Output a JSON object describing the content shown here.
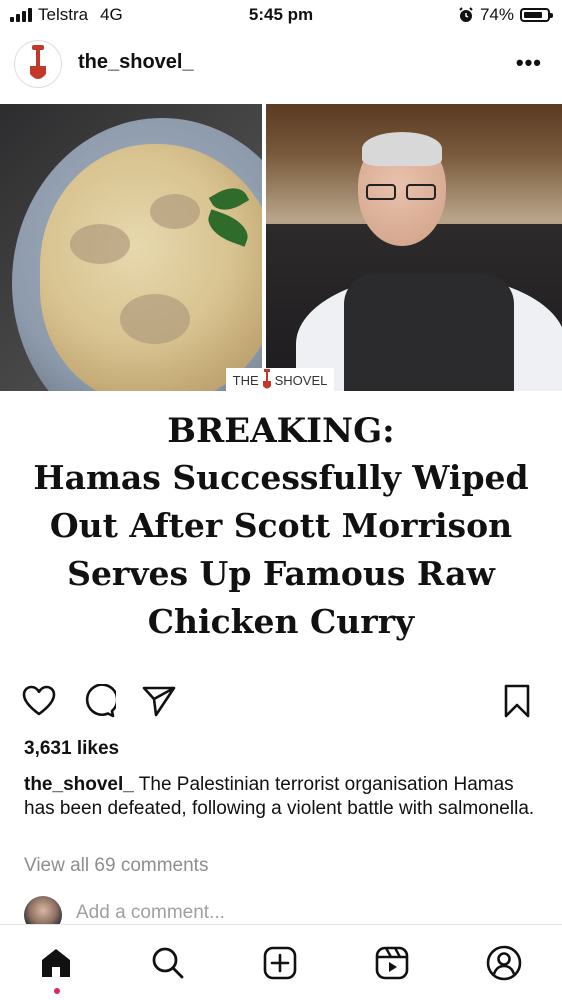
{
  "status_bar": {
    "carrier": "Telstra",
    "network": "4G",
    "time": "5:45 pm",
    "battery": "74%",
    "icons": [
      "signal-icon",
      "alarm-icon",
      "battery-icon"
    ]
  },
  "post": {
    "username": "the_shovel_",
    "more_icon": "more-dots-icon",
    "image": {
      "logo_left": "THE",
      "logo_right": "SHOVEL"
    },
    "headline": {
      "line1": "BREAKING:",
      "line2": "Hamas Successfully Wiped",
      "line3": "Out After Scott Morrison",
      "line4": "Serves Up Famous Raw",
      "line5": "Chicken Curry"
    },
    "actions": [
      "heart-icon",
      "comment-icon",
      "share-icon",
      "bookmark-icon"
    ],
    "likes": "3,631 likes",
    "caption_user": "the_shovel_",
    "caption_text": "The Palestinian terrorist organisation Hamas has been defeated, following a violent battle with salmonella.",
    "view_comments": "View all 69 comments",
    "add_comment_placeholder": "Add a comment..."
  },
  "bottom_nav": [
    "home-icon",
    "search-icon",
    "create-icon",
    "reels-icon",
    "profile-icon"
  ],
  "colors": {
    "shovel_red": "#c0392b",
    "notification_dot": "#e0245e",
    "muted_text": "#8e8e8e"
  }
}
